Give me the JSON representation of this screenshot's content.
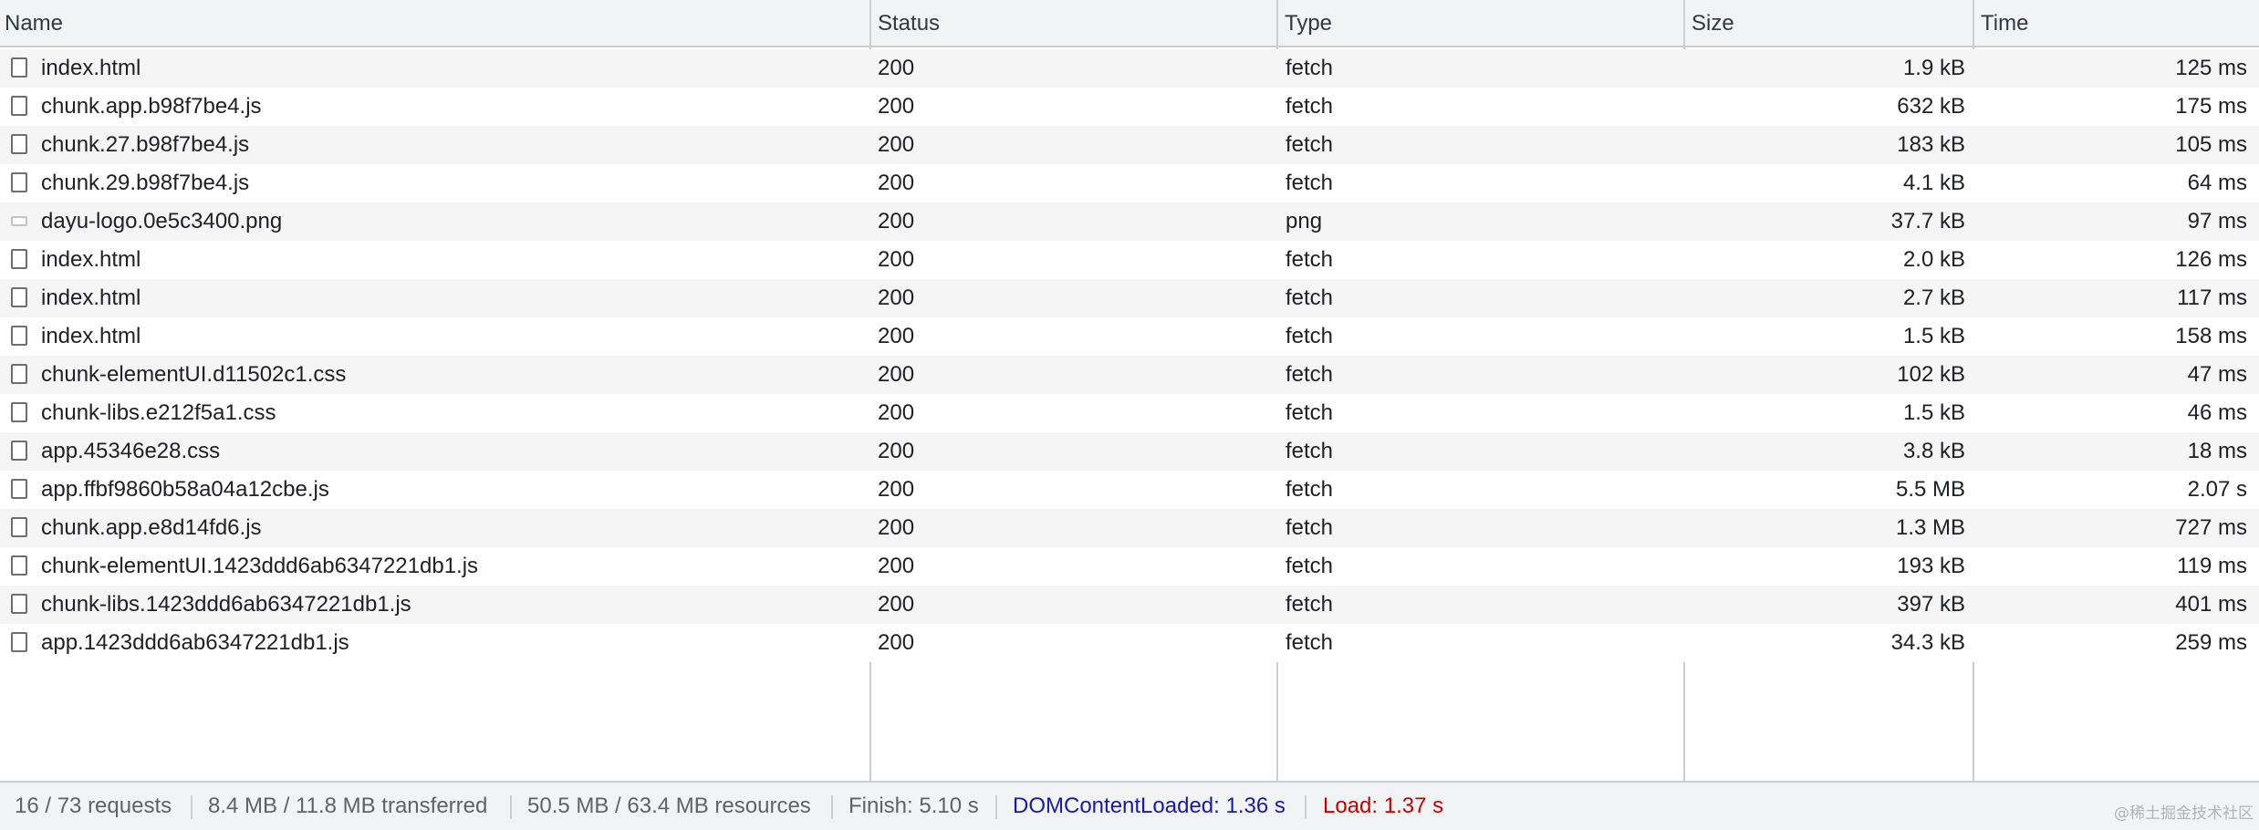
{
  "columns": {
    "name": "Name",
    "status": "Status",
    "type": "Type",
    "size": "Size",
    "time": "Time"
  },
  "requests": [
    {
      "name": "index.html",
      "status": "200",
      "type": "fetch",
      "size": "1.9 kB",
      "time": "125 ms",
      "icon": "document-icon"
    },
    {
      "name": "chunk.app.b98f7be4.js",
      "status": "200",
      "type": "fetch",
      "size": "632 kB",
      "time": "175 ms",
      "icon": "document-icon"
    },
    {
      "name": "chunk.27.b98f7be4.js",
      "status": "200",
      "type": "fetch",
      "size": "183 kB",
      "time": "105 ms",
      "icon": "document-icon"
    },
    {
      "name": "chunk.29.b98f7be4.js",
      "status": "200",
      "type": "fetch",
      "size": "4.1 kB",
      "time": "64 ms",
      "icon": "document-icon"
    },
    {
      "name": "dayu-logo.0e5c3400.png",
      "status": "200",
      "type": "png",
      "size": "37.7 kB",
      "time": "97 ms",
      "icon": "image-icon"
    },
    {
      "name": "index.html",
      "status": "200",
      "type": "fetch",
      "size": "2.0 kB",
      "time": "126 ms",
      "icon": "document-icon"
    },
    {
      "name": "index.html",
      "status": "200",
      "type": "fetch",
      "size": "2.7 kB",
      "time": "117 ms",
      "icon": "document-icon"
    },
    {
      "name": "index.html",
      "status": "200",
      "type": "fetch",
      "size": "1.5 kB",
      "time": "158 ms",
      "icon": "document-icon"
    },
    {
      "name": "chunk-elementUI.d11502c1.css",
      "status": "200",
      "type": "fetch",
      "size": "102 kB",
      "time": "47 ms",
      "icon": "document-icon"
    },
    {
      "name": "chunk-libs.e212f5a1.css",
      "status": "200",
      "type": "fetch",
      "size": "1.5 kB",
      "time": "46 ms",
      "icon": "document-icon"
    },
    {
      "name": "app.45346e28.css",
      "status": "200",
      "type": "fetch",
      "size": "3.8 kB",
      "time": "18 ms",
      "icon": "document-icon"
    },
    {
      "name": "app.ffbf9860b58a04a12cbe.js",
      "status": "200",
      "type": "fetch",
      "size": "5.5 MB",
      "time": "2.07 s",
      "icon": "document-icon"
    },
    {
      "name": "chunk.app.e8d14fd6.js",
      "status": "200",
      "type": "fetch",
      "size": "1.3 MB",
      "time": "727 ms",
      "icon": "document-icon"
    },
    {
      "name": "chunk-elementUI.1423ddd6ab6347221db1.js",
      "status": "200",
      "type": "fetch",
      "size": "193 kB",
      "time": "119 ms",
      "icon": "document-icon"
    },
    {
      "name": "chunk-libs.1423ddd6ab6347221db1.js",
      "status": "200",
      "type": "fetch",
      "size": "397 kB",
      "time": "401 ms",
      "icon": "document-icon"
    },
    {
      "name": "app.1423ddd6ab6347221db1.js",
      "status": "200",
      "type": "fetch",
      "size": "34.3 kB",
      "time": "259 ms",
      "icon": "document-icon"
    }
  ],
  "summary": {
    "requests": "16 / 73 requests",
    "transferred": "8.4 MB / 11.8 MB transferred",
    "resources": "50.5 MB / 63.4 MB resources",
    "finish": "Finish: 5.10 s",
    "dom_content_loaded": "DOMContentLoaded: 1.36 s",
    "load": "Load: 1.37 s"
  },
  "colors": {
    "dom_content_loaded": "#1a1aa6",
    "load": "#c80000",
    "header_bg": "#f1f3f4",
    "stripe_bg": "#f5f5f5"
  },
  "watermark": "@稀土掘金技术社区"
}
